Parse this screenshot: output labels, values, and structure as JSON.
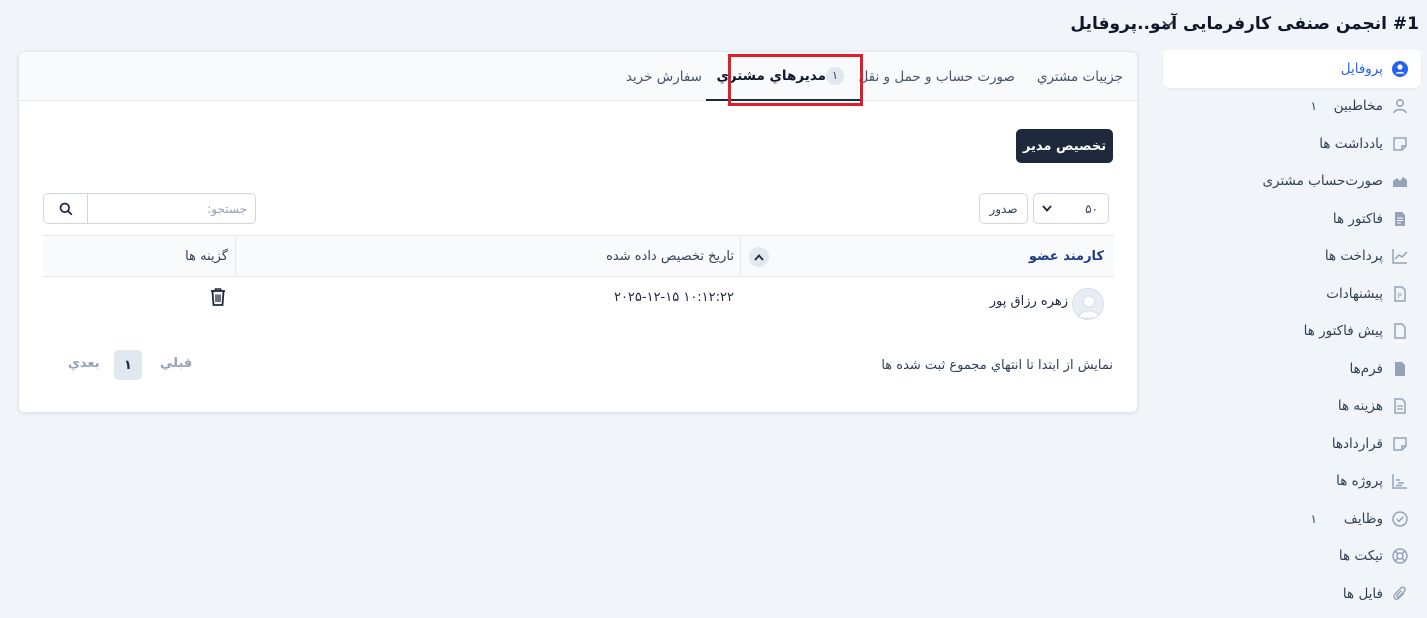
{
  "header": {
    "client_name": "#1 انجمن صنفی کارفرمایی آمو...",
    "page_title": "پروفایل"
  },
  "sidebar": {
    "items": [
      {
        "label": "پروفایل",
        "icon": "user-circle-icon",
        "active": true,
        "count": ""
      },
      {
        "label": "مخاطبین",
        "icon": "user-icon",
        "active": false,
        "count": "۱"
      },
      {
        "label": "یادداشت ها",
        "icon": "note-icon",
        "active": false,
        "count": ""
      },
      {
        "label": "صورت‌حساب مشتری",
        "icon": "area-chart-icon",
        "active": false,
        "count": ""
      },
      {
        "label": "فاکتور ها",
        "icon": "document-icon",
        "active": false,
        "count": ""
      },
      {
        "label": "پرداخت ها",
        "icon": "line-chart-icon",
        "active": false,
        "count": ""
      },
      {
        "label": "پیشنهادات",
        "icon": "proposal-icon",
        "active": false,
        "count": ""
      },
      {
        "label": "پیش فاکتور ها",
        "icon": "file-icon",
        "active": false,
        "count": ""
      },
      {
        "label": "فرم‌ها",
        "icon": "form-icon",
        "active": false,
        "count": ""
      },
      {
        "label": "هزینه ها",
        "icon": "expense-icon",
        "active": false,
        "count": ""
      },
      {
        "label": "قراردادها",
        "icon": "contract-icon",
        "active": false,
        "count": ""
      },
      {
        "label": "پروژه ها",
        "icon": "chart-icon",
        "active": false,
        "count": ""
      },
      {
        "label": "وظایف",
        "icon": "check-circle-icon",
        "active": false,
        "count": "۱"
      },
      {
        "label": "تیکت ها",
        "icon": "lifebuoy-icon",
        "active": false,
        "count": ""
      },
      {
        "label": "فایل ها",
        "icon": "paperclip-icon",
        "active": false,
        "count": ""
      }
    ]
  },
  "tabs": [
    {
      "label": "جزییات مشتري",
      "active": false
    },
    {
      "label": "صورت حساب و حمل و نقل",
      "active": false
    },
    {
      "label": "مديرهاي مشتري",
      "active": true,
      "badge": "۱"
    },
    {
      "label": "سفارش خريد",
      "active": false
    }
  ],
  "actions": {
    "assign_admin_label": "تخصیص مدیر",
    "export_label": "صدور",
    "page_size_value": "۵۰",
    "search_placeholder": "جستجو:"
  },
  "table": {
    "columns": [
      "کارمند عضو",
      "تاریخ تخصیص داده شده",
      "گزینه ها"
    ],
    "rows": [
      {
        "member": "زهره رزاق پور",
        "date_assigned": "۲۰۲۵-۱۲-۱۵ ۱۰:۱۲:۲۲"
      }
    ]
  },
  "footer": {
    "info": "نمايش از ابتدا تا انتهاي مجموع ثبت شده ها",
    "prev_label": "قبلي",
    "page_number": "۱",
    "next_label": "بعدي"
  },
  "colors": {
    "accent": "#2563eb",
    "primary_button": "#1e293b",
    "highlight_box": "#e11d2a"
  }
}
